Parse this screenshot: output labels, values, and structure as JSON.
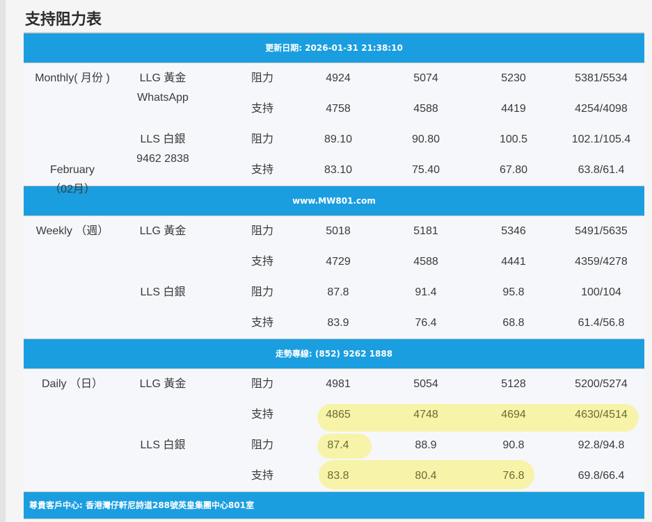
{
  "page_title": "支持阻力表",
  "update_bar": "更新日期: 2026-01-31 21:38:10",
  "site_bar": "www.MW801.com",
  "hotline_bar": "走勢專線: (852) 9262 1888",
  "footer_bar": "尊貴客戶中心: 香港灣仔軒尼詩道288號英皇集團中心801室",
  "monthly": {
    "period_line1": "Monthly( 月份 )",
    "period_line2": "February",
    "period_line3": "（02月）",
    "gold_label": "LLG 黃金",
    "gold_sub": "WhatsApp",
    "silver_label": "LLS 白銀",
    "silver_sub": "9462 2838",
    "rows": [
      {
        "type": "阻力",
        "v1": "4924",
        "v2": "5074",
        "v3": "5230",
        "v4": "5381/5534"
      },
      {
        "type": "支持",
        "v1": "4758",
        "v2": "4588",
        "v3": "4419",
        "v4": "4254/4098"
      },
      {
        "type": "阻力",
        "v1": "89.10",
        "v2": "90.80",
        "v3": "100.5",
        "v4": "102.1/105.4"
      },
      {
        "type": "支持",
        "v1": "83.10",
        "v2": "75.40",
        "v3": "67.80",
        "v4": "63.8/61.4"
      }
    ]
  },
  "weekly": {
    "period_line1": "Weekly （週）",
    "gold_label": "LLG 黃金",
    "silver_label": "LLS 白銀",
    "rows": [
      {
        "type": "阻力",
        "v1": "5018",
        "v2": "5181",
        "v3": "5346",
        "v4": "5491/5635"
      },
      {
        "type": "支持",
        "v1": "4729",
        "v2": "4588",
        "v3": "4441",
        "v4": "4359/4278"
      },
      {
        "type": "阻力",
        "v1": "87.8",
        "v2": "91.4",
        "v3": "95.8",
        "v4": "100/104"
      },
      {
        "type": "支持",
        "v1": "83.9",
        "v2": "76.4",
        "v3": "68.8",
        "v4": "61.4/56.8"
      }
    ]
  },
  "daily": {
    "period_line1": "Daily （日）",
    "gold_label": "LLG 黃金",
    "silver_label": "LLS 白銀",
    "rows": [
      {
        "type": "阻力",
        "v1": "4981",
        "v2": "5054",
        "v3": "5128",
        "v4": "5200/5274"
      },
      {
        "type": "支持",
        "v1": "4865",
        "v2": "4748",
        "v3": "4694",
        "v4": "4630/4514"
      },
      {
        "type": "阻力",
        "v1": "87.4",
        "v2": "88.9",
        "v3": "90.8",
        "v4": "92.8/94.8"
      },
      {
        "type": "支持",
        "v1": "83.8",
        "v2": "80.4",
        "v3": "76.8",
        "v4": "69.8/66.4"
      }
    ]
  },
  "colors": {
    "header_bar": "#1a9ee0",
    "highlight": "#f7f39b",
    "row_bg": "#f6f7fb"
  }
}
